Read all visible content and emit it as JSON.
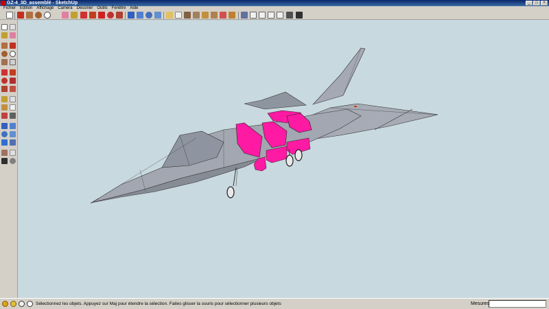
{
  "window": {
    "title": "GZ-4_3D_assemblé - SketchUp"
  },
  "menu": {
    "items": [
      "Fichier",
      "Edition",
      "Affichage",
      "Caméra",
      "Dessiner",
      "Outils",
      "Fenêtre",
      "Aide"
    ]
  },
  "status": {
    "hint": "Sélectionnez les objets. Appuyez sur Maj pour étendre la sélection. Faites glisser la souris pour sélectionner plusieurs objets",
    "measure_label": "Mesures",
    "measure_value": ""
  },
  "colors": {
    "viewport_bg": "#c8d9df",
    "selected_faces": "#ff1aa3",
    "model_gray": "#9aa0aa",
    "chrome": "#d4d0c8",
    "titlebar": "#0a246a"
  },
  "toolbar": {
    "icons": [
      "select-icon",
      "pencil-icon",
      "rectangle-icon",
      "circle-icon",
      "arc-icon",
      "eraser-icon",
      "tape-icon",
      "paint-icon",
      "pushpull-icon",
      "move-icon",
      "rotate-icon",
      "scale-icon",
      "offset-icon",
      "followme-icon",
      "text-icon",
      "axes-icon",
      "dimension-icon",
      "protractor-icon",
      "orbit-icon",
      "pan-icon",
      "zoom-icon",
      "zoom-window-icon",
      "zoom-extents-icon",
      "previous-icon",
      "next-icon",
      "position-camera-icon",
      "walk-icon",
      "lookaround-icon",
      "section-icon",
      "iso-view-icon",
      "top-view-icon",
      "front-view-icon",
      "right-view-icon",
      "back-view-icon",
      "left-view-icon",
      "xray-icon",
      "wireframe-icon",
      "hidden-line-icon",
      "shaded-icon",
      "textured-icon",
      "monochrome-icon"
    ]
  }
}
